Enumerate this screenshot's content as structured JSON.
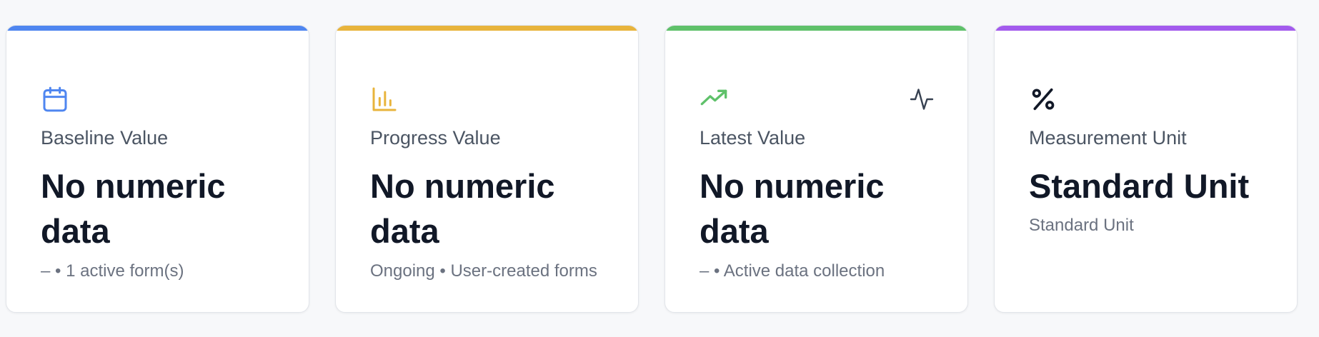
{
  "cards": [
    {
      "accent_color": "#4f86f0",
      "icon": "calendar-icon",
      "label": "Baseline Value",
      "value": "No numeric data",
      "subtitle": "– • 1 active form(s)"
    },
    {
      "accent_color": "#e8b43c",
      "icon": "bar-chart-icon",
      "label": "Progress Value",
      "value": "No numeric data",
      "subtitle": "Ongoing • User-created forms"
    },
    {
      "accent_color": "#5fc16a",
      "icon": "trending-up-icon",
      "corner_icon": "activity-icon",
      "label": "Latest Value",
      "value": "No numeric data",
      "subtitle": "– • Active data collection"
    },
    {
      "accent_color": "#a35bed",
      "icon": "percent-icon",
      "label": "Measurement Unit",
      "value": "Standard Unit",
      "subtitle": "Standard Unit"
    }
  ]
}
